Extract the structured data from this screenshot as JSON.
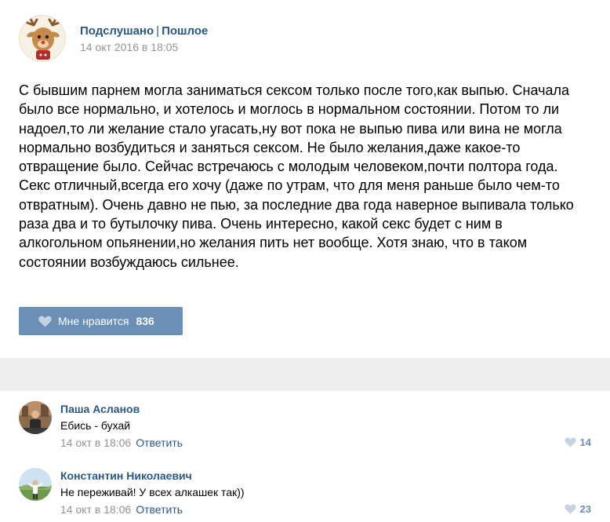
{
  "post": {
    "author": "Подслушано",
    "separator": "|",
    "category": "Пошлое",
    "date": "14 окт 2016 в 18:05",
    "text": "С бывшим парнем могла заниматься сексом только после того,как выпью. Сначала\nбыло все нормально, и хотелось и моглось в нормальном состоянии. Потом то ли\nнадоел,то ли желание стало угасать,ну вот пока не выпью пива или вина не могла\nнормально возбудиться и заняться сексом. Не было желания,даже какое-то\nотвращение было. Сейчас встречаюсь с молодым человеком,почти полтора года.\nСекс отличный,всегда его хочу (даже по утрам, что для меня раньше было чем-то\nотвратным). Очень давно не пью, за последние два года наверное выпивала только\nраза два и то бутылочку пива. Очень интересно, какой секс будет с ним в\nалкогольном опьянении,но желания пить нет вообще. Хотя знаю, что в таком\nсостоянии возбуждаюсь сильнее.",
    "like_label": "Мне нравится",
    "like_count": "836"
  },
  "comments": [
    {
      "name": "Паша Асланов",
      "text": "Ебись - бухай",
      "date": "14 окт в 18:06",
      "reply_label": "Ответить",
      "likes": "14"
    },
    {
      "name": "Константин Николаевич",
      "text": "Не переживай! У всех алкашек так))",
      "date": "14 окт в 18:06",
      "reply_label": "Ответить",
      "likes": "23"
    }
  ],
  "colors": {
    "link": "#2a5885",
    "like_button": "#6b8fb5",
    "meta": "#939393",
    "gap": "#edeef0"
  },
  "icons": {
    "avatar": "deer-avatar",
    "like": "heart-icon"
  }
}
